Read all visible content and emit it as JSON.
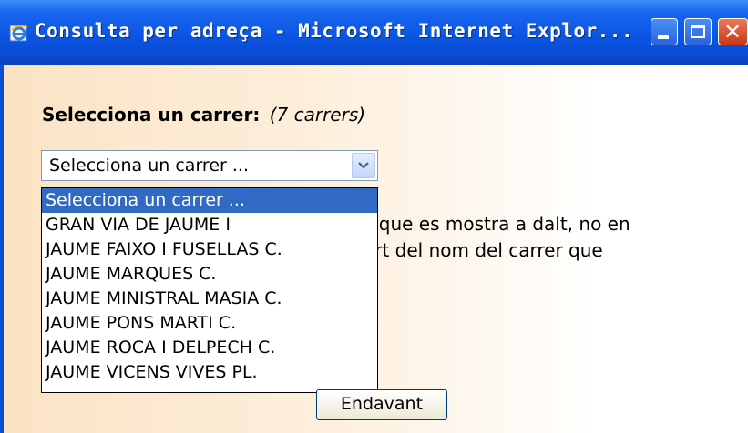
{
  "window": {
    "title": "Consulta per adreça - Microsoft Internet Explor..."
  },
  "heading": {
    "label": "Selecciona un carrer:",
    "count": "(7 carrers)"
  },
  "select": {
    "value": "Selecciona un carrer ..."
  },
  "options": [
    "Selecciona un carrer ...",
    "GRAN VIA DE JAUME I",
    "JAUME FAIXO I FUSELLAS C.",
    "JAUME MARQUES C.",
    "JAUME MINISTRAL MASIA C.",
    "JAUME PONS MARTI C.",
    "JAUME ROCA I DELPECH C.",
    "JAUME VICENS VIVES PL."
  ],
  "background_text": {
    "line1": "s que es mostra a dalt, no en",
    "line2": "art del nom del carrer que"
  },
  "button": {
    "label": "Endavant"
  },
  "colors": {
    "titlebar": "#0b55e3",
    "selection": "#316ac5"
  }
}
